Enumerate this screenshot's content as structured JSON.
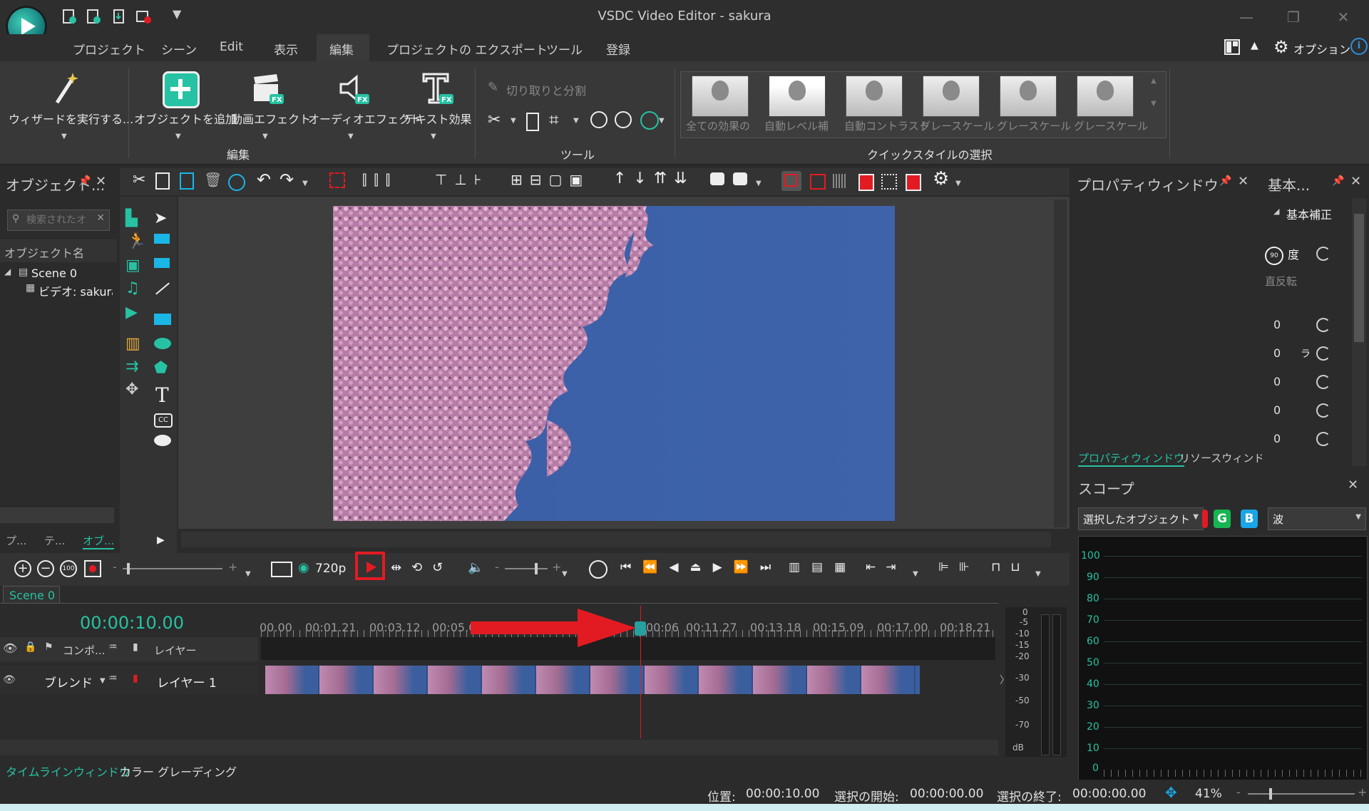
{
  "window": {
    "title": "VSDC Video Editor - sakura",
    "minimize": "—",
    "restore": "❐",
    "close": "✕"
  },
  "menu": {
    "items": [
      "プロジェクト",
      "シーン",
      "Edit",
      "表示",
      "編集",
      "プロジェクトの エクスポート",
      "ツール",
      "登録"
    ],
    "active": "編集",
    "options_label": "オプション"
  },
  "ribbon": {
    "wizard": "ウィザードを実行する...",
    "add_object": "オブジェクトを追加",
    "video_effects": "動画エフェクト",
    "audio_effects": "オーディオエフェクト",
    "text_effects": "テキスト効果",
    "group_edit": "編集",
    "cut_split": "切り取りと分割",
    "group_tools": "ツール",
    "group_quickstyle": "クイックスタイルの選択",
    "quick_styles": [
      "全ての効果の",
      "自動レベル補",
      "自動コントラスト",
      "グレースケール",
      "グレースケール",
      "グレースケール"
    ],
    "fx_badge": "FX"
  },
  "left_panel": {
    "title": "オブジェクト...",
    "search_placeholder": "検索されたオ",
    "column": "オブジェクト名",
    "tree": [
      "Scene 0",
      "ビデオ: sakura_"
    ],
    "tabs": [
      "プ...",
      "テ...",
      "オブ..."
    ]
  },
  "properties_panel": {
    "title": "プロパティウィンドウ",
    "tabs": [
      "プロパティウィンドウ",
      "リソースウィンドウ"
    ]
  },
  "basic_panel": {
    "title": "基本...",
    "section": "基本補正",
    "rotate_label": "度",
    "flip_label": "直反転",
    "values": [
      "0",
      "0",
      "0",
      "0",
      "0"
    ],
    "partial_label": "ラ"
  },
  "scope": {
    "title": "スコープ",
    "source": "選択したオブジェクト",
    "btn_g": "G",
    "btn_b": "B",
    "mode": "波",
    "y_labels": [
      "100",
      "90",
      "80",
      "70",
      "60",
      "50",
      "40",
      "30",
      "20",
      "10",
      "0"
    ]
  },
  "timeline": {
    "resolution": "720p",
    "scene_tab": "Scene 0",
    "timecode": "00:00:10.00",
    "col_composition": "コンポ...",
    "col_layer": "レイヤー",
    "blend": "ブレンド",
    "layer_name": "レイヤー 1",
    "ticks": [
      "00.00",
      "00:01.21",
      "00:03.12",
      "00:05.0",
      "00:06",
      "00:11.27",
      "00:13.18",
      "00:15.09",
      "00:17.00",
      "00:18.21"
    ],
    "db_labels": [
      "0",
      "-5",
      "-10",
      "-15",
      "-20",
      "-30",
      "-50",
      "-70",
      "dB"
    ],
    "bottom_tabs": [
      "タイムラインウィンドウ",
      "カラー グレーディング"
    ]
  },
  "status": {
    "position_label": "位置:",
    "position_value": "00:00:10.00",
    "sel_start_label": "選択の開始:",
    "sel_start_value": "00:00:00.00",
    "sel_end_label": "選択の終了:",
    "sel_end_value": "00:00:00.00",
    "zoom": "41%"
  },
  "colors": {
    "accent": "#26c2a3",
    "highlight": "#e21b23"
  }
}
